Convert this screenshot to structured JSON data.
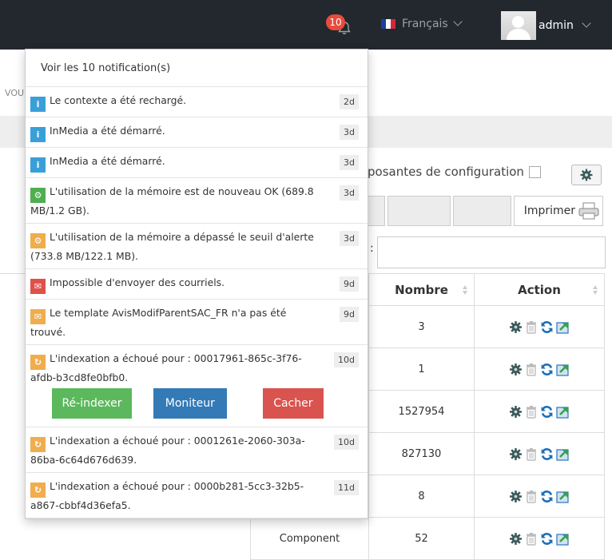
{
  "topbar": {
    "notification_count": "10",
    "language": "Français",
    "username": "admin"
  },
  "background": {
    "left_fragment": "VOU",
    "config_label": "posantes de configuration",
    "print_label": "Imprimer",
    "search_colon": ":",
    "table": {
      "headers": [
        "Nombre",
        "Action"
      ],
      "rows": [
        {
          "name": "",
          "count": "3"
        },
        {
          "name": "",
          "count": "1"
        },
        {
          "name": "",
          "count": "1527954"
        },
        {
          "name": "",
          "count": "827130"
        },
        {
          "name": "",
          "count": "8"
        },
        {
          "name": "Component",
          "count": "52"
        }
      ]
    }
  },
  "dropdown": {
    "header": "Voir les 10 notification(s)",
    "items": [
      {
        "type": "info",
        "text": "Le contexte a été rechargé.",
        "age": "2d"
      },
      {
        "type": "info",
        "text": "InMedia a été démarré.",
        "age": "3d"
      },
      {
        "type": "info",
        "text": "InMedia a été démarré.",
        "age": "3d"
      },
      {
        "type": "ok",
        "text": "L'utilisation de la mémoire est de nouveau OK (689.8 MB/1.2 GB).",
        "age": "3d"
      },
      {
        "type": "warn",
        "text": "L'utilisation de la mémoire a dépassé le seuil d'alerte (733.8 MB/122.1 MB).",
        "age": "3d"
      },
      {
        "type": "error",
        "text": "Impossible d'envoyer des courriels.",
        "age": "9d"
      },
      {
        "type": "mail",
        "text": "Le template AvisModifParentSAC_FR n'a pas été trouvé.",
        "age": "9d"
      },
      {
        "type": "refresh",
        "text": "L'indexation a échoué pour : 00017961-865c-3f76-afdb-b3cd8fe0bfb0.",
        "age": "10d"
      },
      {
        "type": "refresh",
        "text": "L'indexation a échoué pour : 0001261e-2060-303a-86ba-6c64d676d639.",
        "age": "10d"
      },
      {
        "type": "refresh",
        "text": "L'indexation a échoué pour : 0000b281-5cc3-32b5-a867-cbbf4d36efa5.",
        "age": "11d"
      }
    ],
    "actions": {
      "reindex": "Ré-indexer",
      "monitor": "Moniteur",
      "hide": "Cacher"
    }
  },
  "colors": {
    "topbar": "#23282e",
    "info": "#3a9fd8",
    "ok": "#4fae4f",
    "warn": "#f0ad4e",
    "error": "#e0504a",
    "btn_green": "#5cb85c",
    "btn_blue": "#337ab7",
    "btn_red": "#d9534f"
  }
}
